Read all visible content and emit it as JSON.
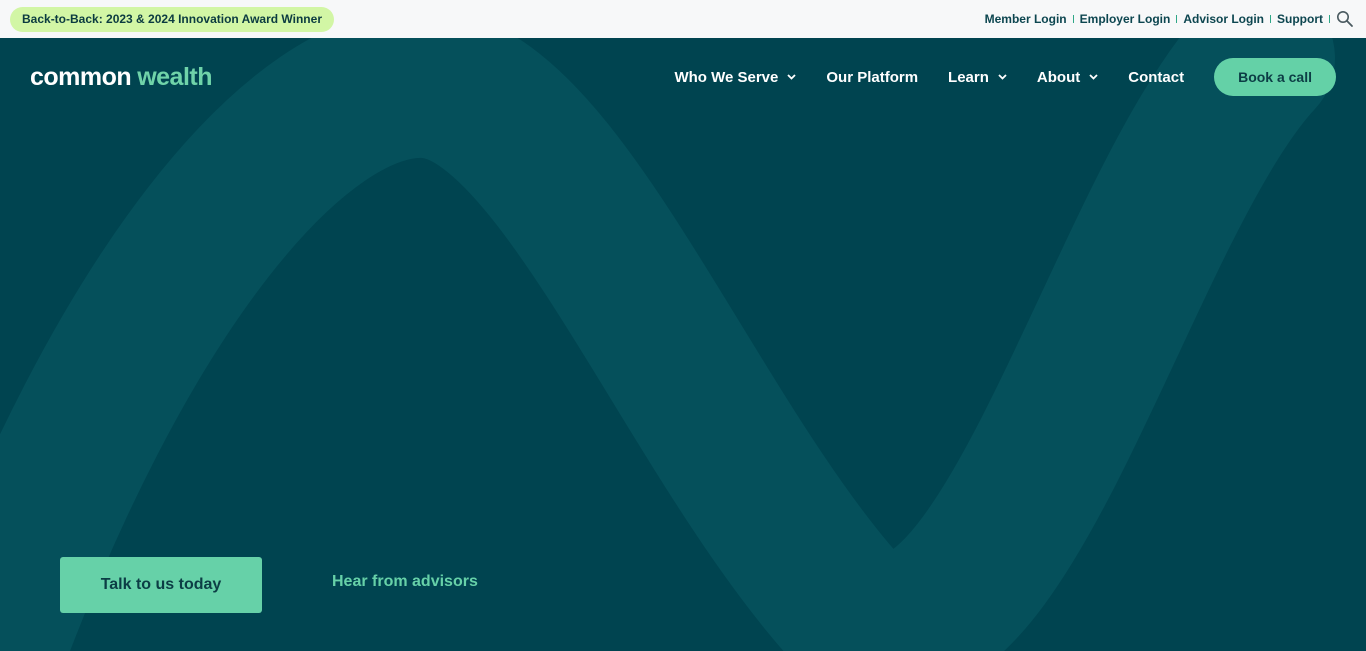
{
  "topbar": {
    "award": "Back-to-Back: 2023 & 2024 Innovation Award Winner",
    "links": [
      "Member Login",
      "Employer Login",
      "Advisor Login",
      "Support"
    ],
    "search_icon": "search-icon"
  },
  "navbar": {
    "logo": {
      "part1": "common",
      "part2": "wealth"
    },
    "items": [
      {
        "label": "Who We Serve",
        "dropdown": true
      },
      {
        "label": "Our Platform",
        "dropdown": false
      },
      {
        "label": "Learn",
        "dropdown": true
      },
      {
        "label": "About",
        "dropdown": true
      },
      {
        "label": "Contact",
        "dropdown": false
      }
    ],
    "cta": "Book a call"
  },
  "hero": {
    "primary_cta": "Talk to us today",
    "secondary_cta": "Hear from advisors"
  },
  "colors": {
    "hero_bg": "#004450",
    "wave": "#05505b",
    "accent": "#66d1a8",
    "award_pill": "#d2f6a5",
    "topbar_bg": "#f7f8f9"
  }
}
